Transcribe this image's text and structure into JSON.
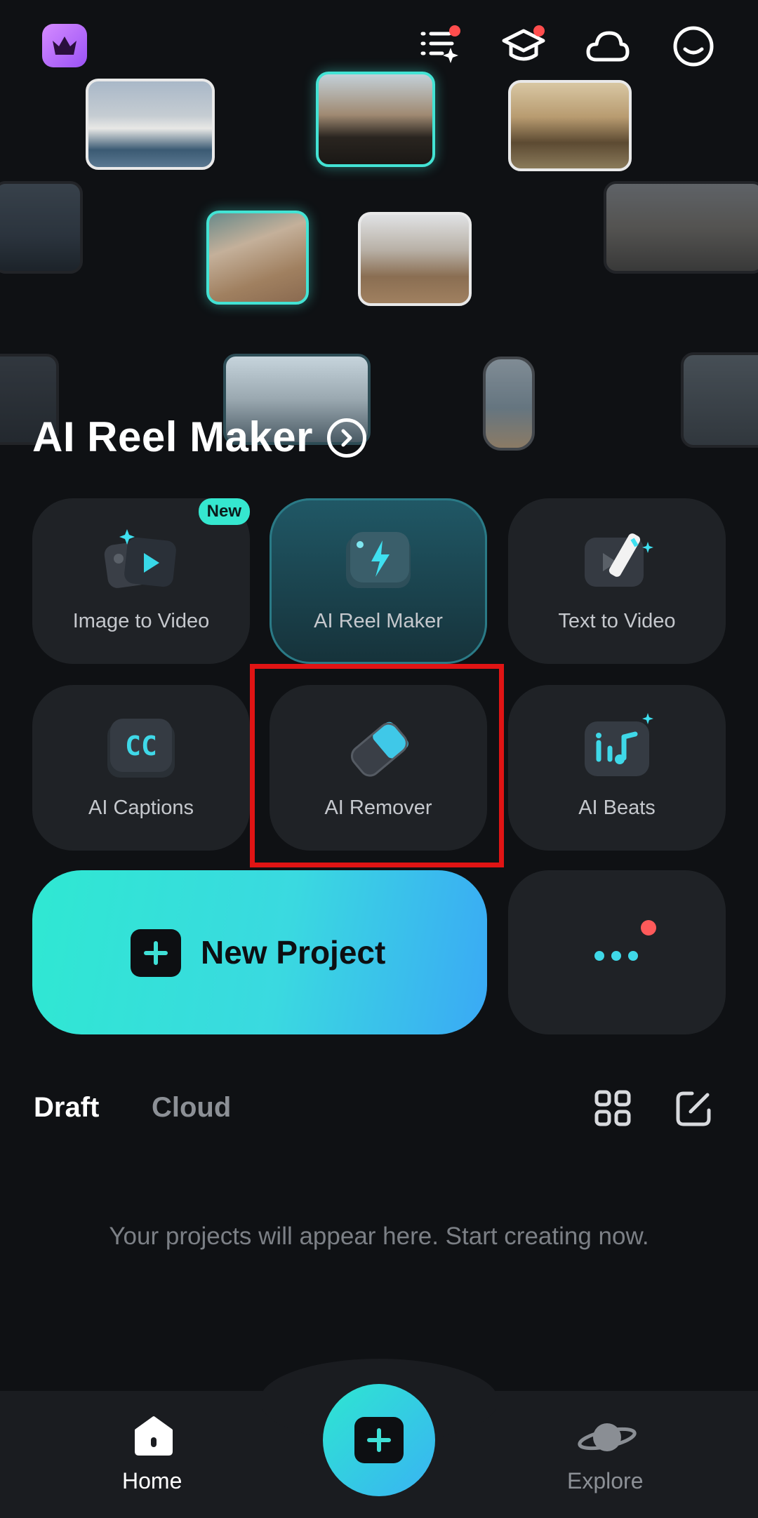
{
  "topbar": {
    "icons": [
      "crown-icon",
      "task-list-icon",
      "graduation-cap-icon",
      "cloud-icon",
      "smiley-profile-icon"
    ]
  },
  "hero": {
    "title": "AI Reel Maker"
  },
  "tools": [
    {
      "label": "Image to Video",
      "badge": "New",
      "icon": "image-to-video-icon"
    },
    {
      "label": "AI Reel Maker",
      "icon": "ai-reel-maker-icon"
    },
    {
      "label": "Text to Video",
      "icon": "text-to-video-icon"
    },
    {
      "label": "AI Captions",
      "icon": "cc-captions-icon"
    },
    {
      "label": "AI Remover",
      "icon": "eraser-icon"
    },
    {
      "label": "AI Beats",
      "icon": "music-beats-icon"
    }
  ],
  "new_project": {
    "label": "New Project"
  },
  "tabs": {
    "draft": "Draft",
    "cloud": "Cloud"
  },
  "empty_state": "Your projects will appear here. Start creating now.",
  "bottom_nav": {
    "home": "Home",
    "explore": "Explore"
  },
  "colors": {
    "accent": "#35e7cf",
    "background": "#0f1114",
    "card": "#1f2226",
    "highlight": "#e01414"
  }
}
